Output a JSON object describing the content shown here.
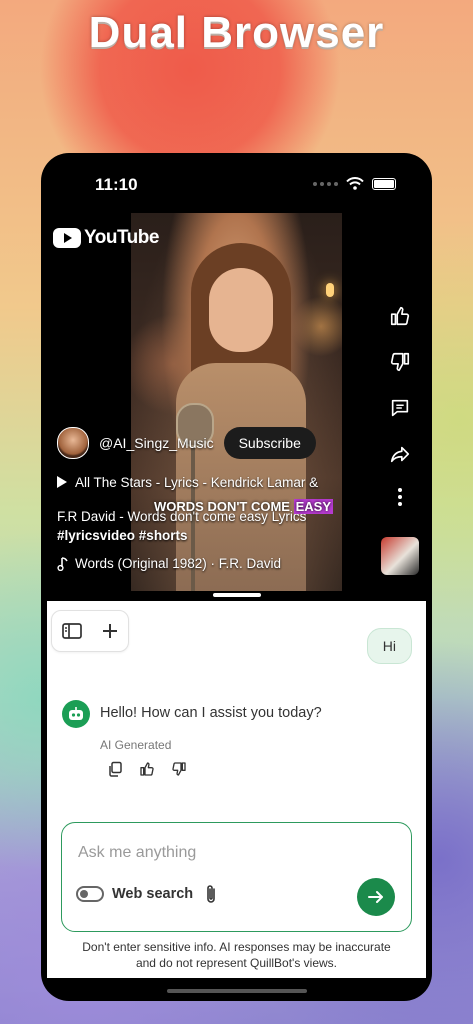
{
  "promo": {
    "title": "Dual Browser"
  },
  "status_bar": {
    "time": "11:10"
  },
  "youtube": {
    "logo_text": "YouTube",
    "channel_name": "@AI_Singz_Music",
    "subscribe_label": "Subscribe",
    "title_line1": "All The Stars - Lyrics - Kendrick Lamar &",
    "title_line2": "F.R David - Words don't come easy Lyrics",
    "lyrics_overlay": "WORDS DON'T COME",
    "lyrics_highlight": "EASY",
    "hashtags": "#lyricsvideo #shorts",
    "sound": "Words (Original 1982) · F.R. David",
    "actions": [
      "like-icon",
      "dislike-icon",
      "comment-icon",
      "share-icon",
      "more-icon"
    ]
  },
  "chat": {
    "user_message": "Hi",
    "bot_message": "Hello! How can I assist you today?",
    "ai_label": "AI Generated",
    "input_placeholder": "Ask me anything",
    "web_search_label": "Web search",
    "disclaimer_line1": "Don't enter sensitive info. AI responses may be inaccurate",
    "disclaimer_line2": "and do not represent QuillBot's views.",
    "accent_color": "#1b8a4b"
  }
}
